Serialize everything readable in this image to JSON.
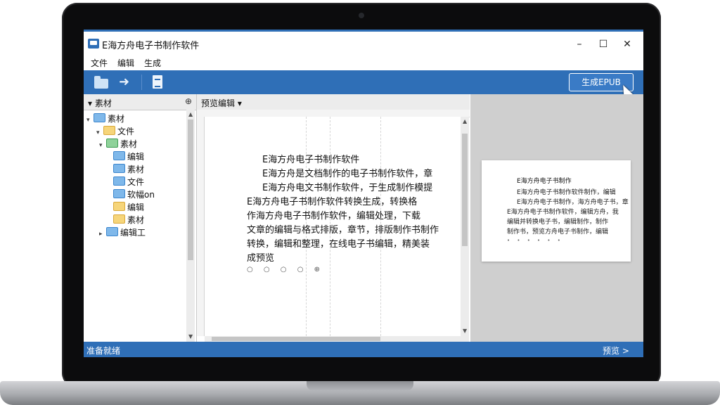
{
  "window": {
    "title": "E海方舟电子书制作软件",
    "minimize_glyph": "–",
    "maximize_glyph": "☐",
    "close_glyph": "✕"
  },
  "menu": {
    "items": [
      "文件",
      "编辑",
      "生成"
    ]
  },
  "toolbar": {
    "icons": [
      "open-folder-icon",
      "forward-arrow-icon",
      "document-icon"
    ],
    "generate_label": "生成EPUB",
    "forward_glyph": "➜"
  },
  "sidebar": {
    "header": "素材",
    "pin_glyph": "⊕",
    "tree": [
      {
        "label": "素材",
        "color": "blue",
        "expanded": true
      },
      {
        "label": "文件",
        "color": "yellow",
        "expanded": true
      },
      {
        "label": "素材",
        "color": "green",
        "expanded": true
      },
      {
        "label": "编辑",
        "color": "blue"
      },
      {
        "label": "素材",
        "color": "blue"
      },
      {
        "label": "文件",
        "color": "blue"
      },
      {
        "label": "软幅on",
        "color": "blue"
      },
      {
        "label": "编辑",
        "color": "yellow"
      },
      {
        "label": "素材",
        "color": "yellow"
      },
      {
        "label": "编辑工",
        "color": "blue"
      }
    ]
  },
  "editor": {
    "tab_label": "预览编辑",
    "title": "E海方舟电子书制作软件",
    "lines": [
      "E海方舟是文档制作的电子书制作软件，章",
      "E海方舟电文书制作软件，于生成制作模提",
      "E海方舟电子书制作软件转换生成，转换格",
      "作海方舟电子书制作软件，编辑处理，下载",
      "文章的编辑与格式排版，章节，排版制作书制作",
      "转换，编辑和整理，在线电子书编辑，精美装",
      "成预览"
    ],
    "icons_row": "○ ○ ○ ○ ⊕"
  },
  "preview": {
    "title": "E海方舟电子书制作",
    "lines": [
      "E海方舟电子书制作软件制作，编辑",
      "E海方舟电子书制作，海方舟电子书，章",
      "E海方舟电子书制作软件，编辑方舟，我",
      "编辑并转换电子书，编辑制作，制作",
      "制作书，预览方舟电子书制作，编辑"
    ],
    "dots": "• • • • • •"
  },
  "status": {
    "left": "准备就绪",
    "right": "预览 >"
  }
}
